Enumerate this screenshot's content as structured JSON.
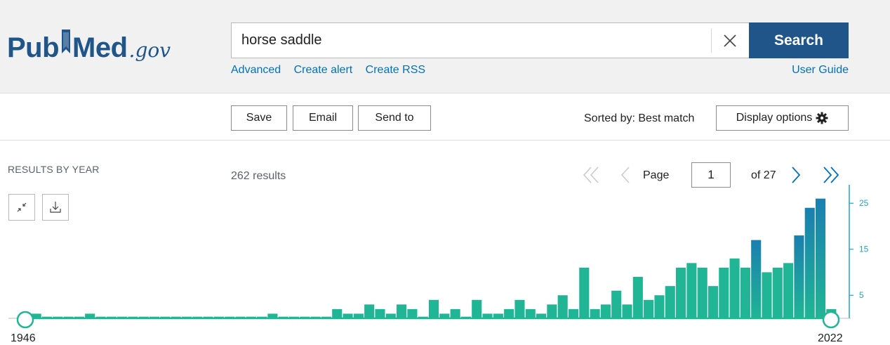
{
  "header": {
    "logo_pub": "Pub",
    "logo_med": "Med",
    "logo_gov": ".gov",
    "search_value": "horse saddle",
    "search_button": "Search",
    "links": [
      "Advanced",
      "Create alert",
      "Create RSS"
    ],
    "user_guide": "User Guide"
  },
  "toolbar": {
    "save": "Save",
    "email": "Email",
    "send_to": "Send to",
    "sorted_by": "Sorted by: Best match",
    "display_options": "Display options"
  },
  "results": {
    "by_year_label": "RESULTS BY YEAR",
    "count": "262 results",
    "page_label": "Page",
    "page_value": "1",
    "of_total": "of 27"
  },
  "colors": {
    "brand": "#20558a",
    "link": "#0071bc",
    "bar": "#20b594",
    "bar_recent": "#1a7fb0",
    "axis": "#20a4c8"
  },
  "icons": [
    "clear-icon",
    "gear-icon",
    "collapse-icon",
    "download-icon",
    "first-page-icon",
    "prev-page-icon",
    "next-page-icon",
    "last-page-icon"
  ],
  "chart_data": {
    "type": "bar",
    "title": "",
    "xlabel": "",
    "ylabel": "",
    "x_start_label": "1946",
    "x_end_label": "2022",
    "y_ticks": [
      5,
      15,
      25
    ],
    "ylim": [
      0,
      29
    ],
    "series": [
      {
        "values": [
          1,
          0,
          0,
          0,
          0,
          1,
          0,
          0,
          0,
          0,
          0,
          0,
          0,
          0,
          0,
          0,
          0,
          0,
          0,
          0,
          0,
          0,
          1,
          0,
          0,
          0,
          0,
          0,
          2,
          1,
          1,
          3,
          2,
          1,
          3,
          2,
          0,
          4,
          1,
          2,
          0,
          4,
          1,
          1,
          2,
          4,
          2,
          1,
          3,
          5,
          2,
          11,
          2,
          3,
          6,
          3,
          9,
          4,
          5,
          7,
          11,
          12,
          11,
          7,
          11,
          13,
          11,
          17,
          10,
          11,
          12,
          18,
          24,
          26,
          2
        ]
      }
    ]
  }
}
